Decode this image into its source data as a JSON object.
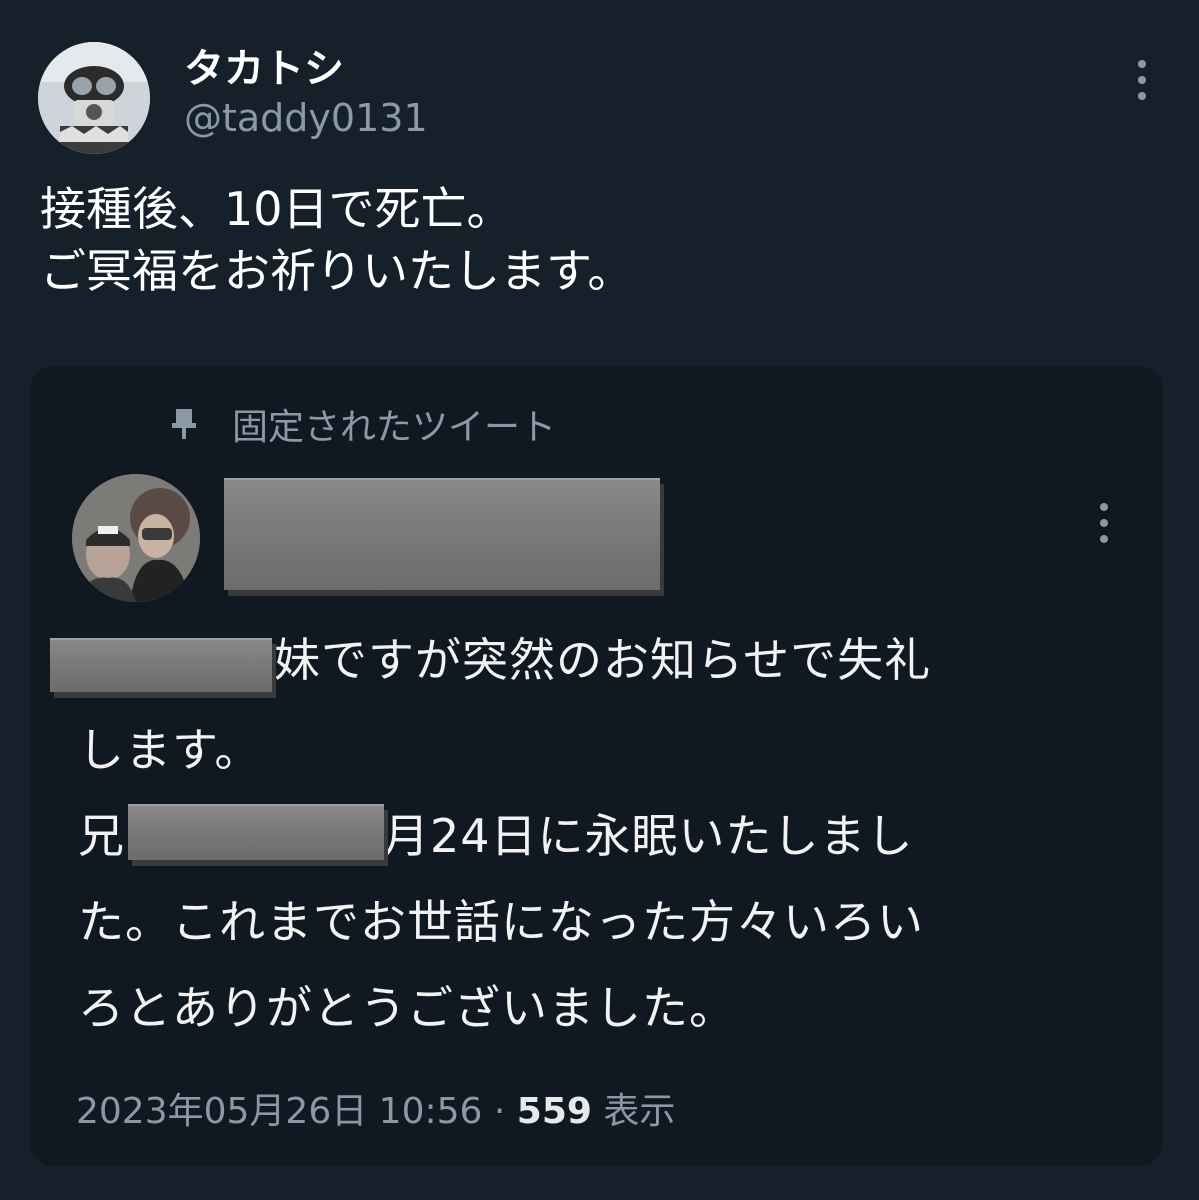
{
  "tweet": {
    "display_name": "タカトシ",
    "handle": "@taddy0131",
    "more_icon": "more-vertical-icon",
    "text_lines": [
      "接種後、10日で死亡。",
      "ご冥福をお祈りいたします。"
    ]
  },
  "quoted": {
    "pinned_icon": "pin-icon",
    "pinned_label": "固定されたツイート",
    "more_icon": "more-vertical-icon",
    "body": {
      "line1_tail": "妹ですが突然のお知らせで失礼",
      "line2": "します。",
      "line3_head": "兄",
      "line3_tail": "月24日に永眠いたしまし",
      "line4": "た。これまでお世話になった方々いろい",
      "line5": "ろとありがとうございました。"
    },
    "timestamp": "2023年05月26日 10:56",
    "separator": "·",
    "views_count": "559",
    "views_label": "表示"
  },
  "colors": {
    "background": "#15202b",
    "card_background": "#101821",
    "secondary_text": "#8b98a5",
    "redaction": "#7a7a7a"
  }
}
